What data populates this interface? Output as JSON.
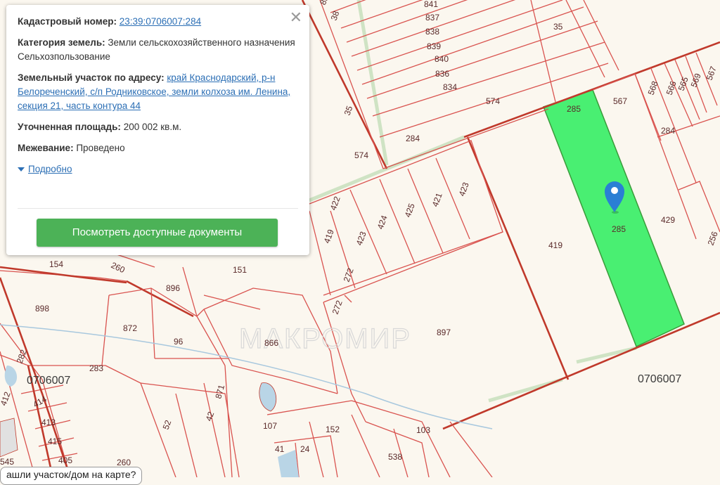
{
  "popup": {
    "close_icon": "close-icon",
    "cadastral_label": "Кадастровый номер:",
    "cadastral_value": "23:39:0706007:284",
    "category_label": "Категория земель:",
    "category_value": "Земли сельскохозяйственного назначения",
    "use_value": "Сельхозпользование",
    "address_label": "Земельный участок по адресу:",
    "address_value": "край Краснодарский, р-н Белореченский, с/п Родниковское, земли колхоза им. Ленина, секция 21, часть контура 44",
    "area_label": "Уточненная площадь:",
    "area_value": "200 002 кв.м.",
    "survey_label": "Межевание:",
    "survey_value": "Проведено",
    "more_link": "Подробно",
    "docs_button": "Посмотреть доступные документы"
  },
  "map": {
    "selected_parcel_color": "#49ef72",
    "quarter_labels": [
      "0706007",
      "0706007"
    ],
    "watermark": "МАКРОМИР",
    "parcel_labels": [
      "839",
      "841",
      "837",
      "838",
      "839",
      "840",
      "836",
      "834",
      "38",
      "35",
      "35",
      "574",
      "574",
      "284",
      "285",
      "567",
      "568",
      "566",
      "565",
      "569",
      "567",
      "284",
      "285",
      "429",
      "256",
      "419",
      "422",
      "424",
      "425",
      "421",
      "423",
      "419",
      "423",
      "272",
      "272",
      "897",
      "154",
      "260",
      "151",
      "896",
      "898",
      "872",
      "96",
      "866",
      "283",
      "282",
      "412",
      "414",
      "413",
      "415",
      "405",
      "545",
      "52",
      "42",
      "871",
      "107",
      "41",
      "24",
      "152",
      "103",
      "538",
      "260"
    ]
  },
  "bottom_tip": "ашли участок/дом на карте?"
}
